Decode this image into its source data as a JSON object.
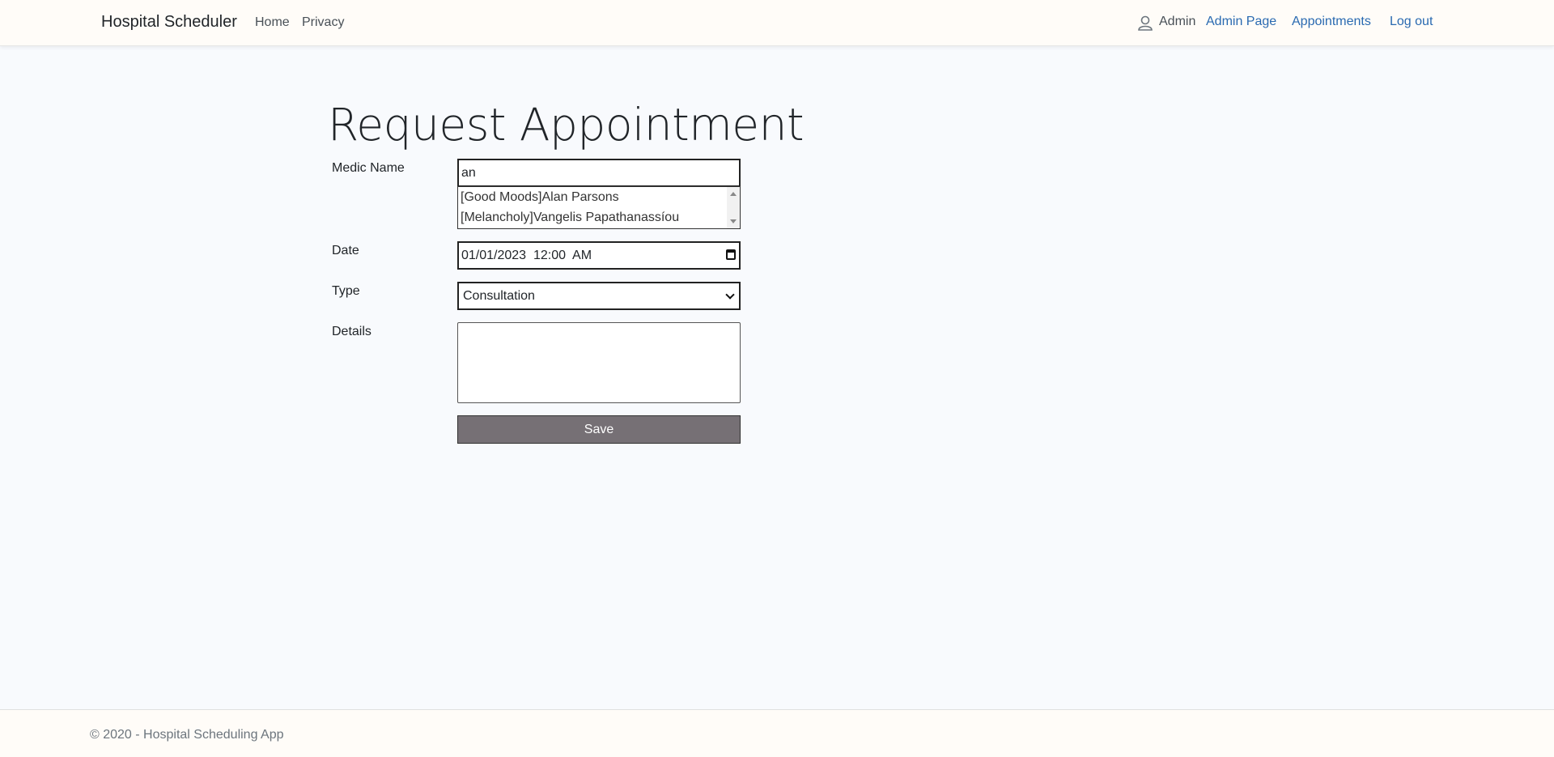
{
  "nav": {
    "brand": "Hospital Scheduler",
    "home": "Home",
    "privacy": "Privacy",
    "user": "Admin",
    "admin_page": "Admin Page",
    "appointments": "Appointments",
    "logout": "Log out"
  },
  "page": {
    "title": "Request Appointment"
  },
  "form": {
    "medic_label": "Medic Name",
    "medic_value": "an",
    "suggestions": [
      "[Good Moods]Alan Parsons",
      "[Melancholy]Vangelis Papathanassíou"
    ],
    "date_label": "Date",
    "date_value": "01/01/2023  12:00  AM",
    "type_label": "Type",
    "type_value": "Consultation",
    "details_label": "Details",
    "details_value": "",
    "save_label": "Save"
  },
  "footer": {
    "text": "© 2020 - Hospital Scheduling App"
  },
  "colors": {
    "link": "#2a6ab1",
    "button": "#767075",
    "background": "#f8fafd",
    "navbar": "#fffcf8"
  }
}
